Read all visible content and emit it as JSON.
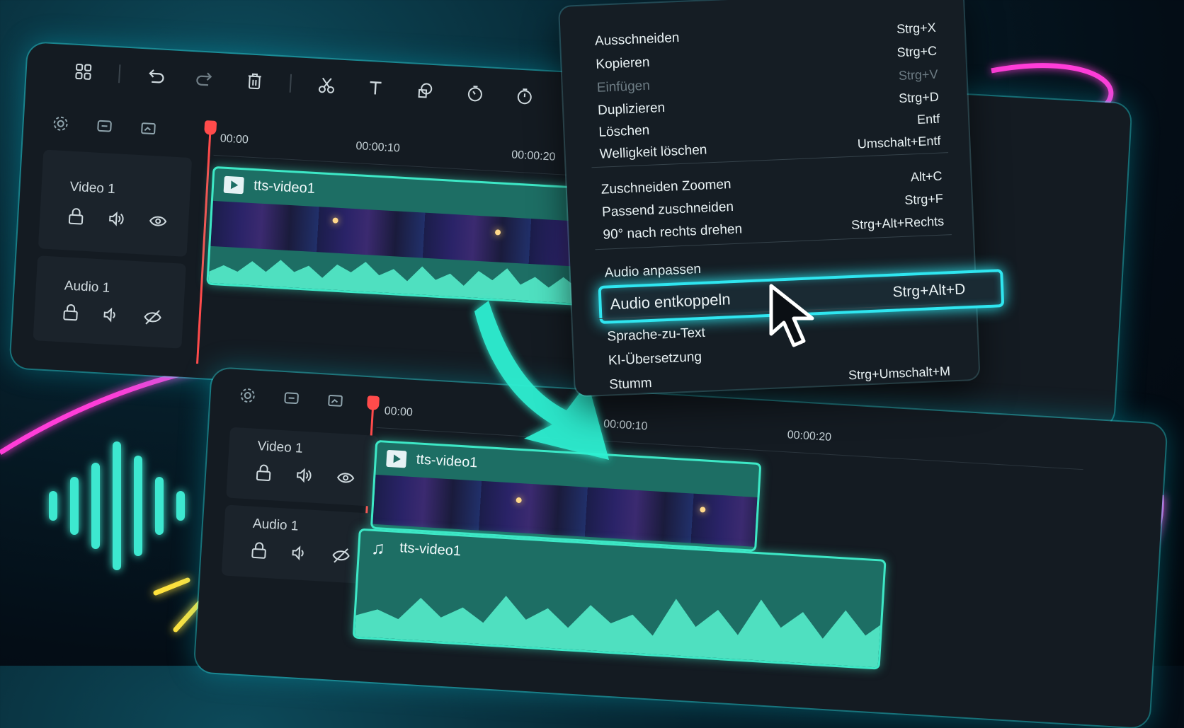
{
  "top_timeline": {
    "ruler": [
      "00:00",
      "00:00:10",
      "00:00:20"
    ],
    "tracks": [
      {
        "name": "Video 1"
      },
      {
        "name": "Audio 1"
      }
    ],
    "clip": {
      "title": "tts-video1"
    }
  },
  "context_menu": {
    "items": [
      {
        "label": "Ausschneiden",
        "shortcut": "Strg+X"
      },
      {
        "label": "Kopieren",
        "shortcut": "Strg+C"
      },
      {
        "label": "Einfügen",
        "shortcut": "Strg+V",
        "disabled": true
      },
      {
        "label": "Duplizieren",
        "shortcut": "Strg+D"
      },
      {
        "label": "Löschen",
        "shortcut": "Entf"
      },
      {
        "label": "Welligkeit löschen",
        "shortcut": "Umschalt+Entf"
      },
      {
        "label": "Zuschneiden Zoomen",
        "shortcut": "Alt+C"
      },
      {
        "label": "Passend zuschneiden",
        "shortcut": "Strg+F"
      },
      {
        "label": "90° nach rechts drehen",
        "shortcut": "Strg+Alt+Rechts"
      },
      {
        "label": "Audio anpassen",
        "shortcut": ""
      },
      {
        "label": "Audio entkoppeln",
        "shortcut": "Strg+Alt+D",
        "highlighted": true
      },
      {
        "label": "Sprache-zu-Text",
        "shortcut": ""
      },
      {
        "label": "KI-Übersetzung",
        "shortcut": ""
      },
      {
        "label": "Stumm",
        "shortcut": "Strg+Umschalt+M"
      }
    ]
  },
  "bottom_timeline": {
    "ruler": [
      "00:00",
      "00:00:10",
      "00:00:20"
    ],
    "tracks": [
      {
        "name": "Video 1"
      },
      {
        "name": "Audio 1"
      }
    ],
    "video_clip": {
      "title": "tts-video1"
    },
    "audio_clip": {
      "title": "tts-video1"
    }
  },
  "colors": {
    "accent": "#3de8c6",
    "highlight": "#2fe6f0",
    "neon_pink": "#ff3dd8",
    "playhead": "#ff4b4b",
    "spark": "#ffe23d"
  }
}
